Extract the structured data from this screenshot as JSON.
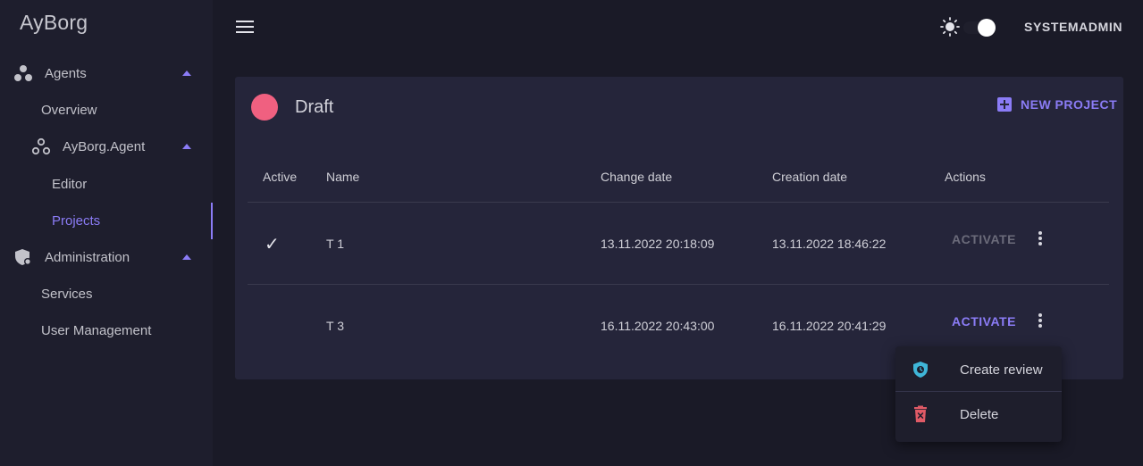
{
  "app": {
    "brand": "AyBorg"
  },
  "sidebar": {
    "items": [
      {
        "label": "Agents"
      },
      {
        "label": "Overview"
      },
      {
        "label": "AyBorg.Agent"
      },
      {
        "label": "Editor"
      },
      {
        "label": "Projects"
      },
      {
        "label": "Administration"
      },
      {
        "label": "Services"
      },
      {
        "label": "User Management"
      }
    ]
  },
  "topbar": {
    "user": "SYSTEMADMIN",
    "theme_toggle_on": true
  },
  "card": {
    "title": "Draft",
    "status_color": "#f06080",
    "new_project_label": "NEW PROJECT",
    "columns": [
      "Active",
      "Name",
      "Change date",
      "Creation date",
      "Actions"
    ],
    "rows": [
      {
        "active": true,
        "active_mark": "✓",
        "name": "T 1",
        "change_date": "13.11.2022 20:18:09",
        "creation_date": "13.11.2022 18:46:22",
        "action_label": "ACTIVATE",
        "action_enabled": false
      },
      {
        "active": false,
        "active_mark": "",
        "name": "T 3",
        "change_date": "16.11.2022 20:43:00",
        "creation_date": "16.11.2022 20:41:29",
        "action_label": "ACTIVATE",
        "action_enabled": true
      }
    ]
  },
  "context_menu": {
    "items": [
      {
        "label": "Create review",
        "icon": "shield-clock-icon",
        "color": "#3fb6d8"
      },
      {
        "label": "Delete",
        "icon": "trash-icon",
        "color": "#e05a66"
      }
    ]
  },
  "colors": {
    "accent": "#8b7cf6",
    "background": "#1a1a27",
    "sidebar": "#1e1e2d",
    "card": "#25253a"
  }
}
